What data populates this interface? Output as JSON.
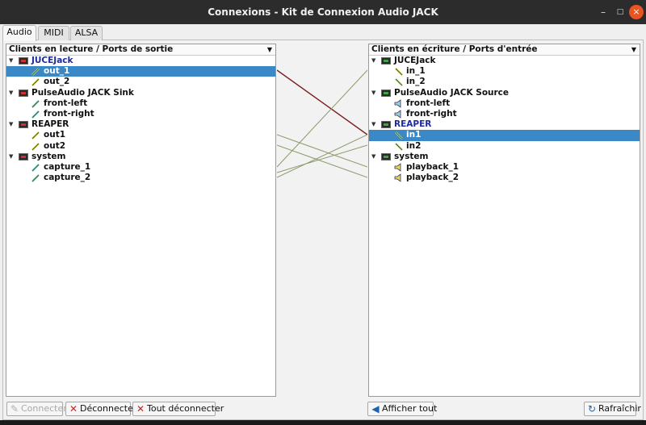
{
  "window": {
    "title": "Connexions - Kit de Connexion Audio JACK",
    "minimize_glyph": "–",
    "maximize_glyph": "□",
    "close_glyph": "×"
  },
  "tabs": [
    {
      "label": "Audio",
      "active": true
    },
    {
      "label": "MIDI"
    },
    {
      "label": "ALSA"
    }
  ],
  "left_panel": {
    "header": "Clients en lecture / Ports de sortie",
    "clients": [
      {
        "name": "JUCEJack",
        "highlight": true,
        "ports": [
          "out_1",
          "out_2"
        ]
      },
      {
        "name": "PulseAudio JACK Sink",
        "ports": [
          "front-left",
          "front-right"
        ]
      },
      {
        "name": "REAPER",
        "ports": [
          "out1",
          "out2"
        ]
      },
      {
        "name": "system",
        "ports": [
          "capture_1",
          "capture_2"
        ]
      }
    ]
  },
  "right_panel": {
    "header": "Clients en écriture / Ports d'entrée",
    "clients": [
      {
        "name": "JUCEJack",
        "ports": [
          "in_1",
          "in_2"
        ]
      },
      {
        "name": "PulseAudio JACK Source",
        "ports": [
          "front-left",
          "front-right"
        ]
      },
      {
        "name": "REAPER",
        "highlight": true,
        "ports": [
          "in1",
          "in2"
        ]
      },
      {
        "name": "system",
        "ports": [
          "playback_1",
          "playback_2"
        ]
      }
    ]
  },
  "buttons": {
    "connect": "Connecter",
    "disconnect": "Déconnecter",
    "disconnect_all": "Tout déconnecter",
    "show_all": "Afficher tout",
    "refresh": "Rafraîchir"
  },
  "colors": {
    "selection": "#3a88c5",
    "highlight_text": "#1c2aa0",
    "selected_connection": "#7a1f1f",
    "connection": "#8a9a6a"
  }
}
